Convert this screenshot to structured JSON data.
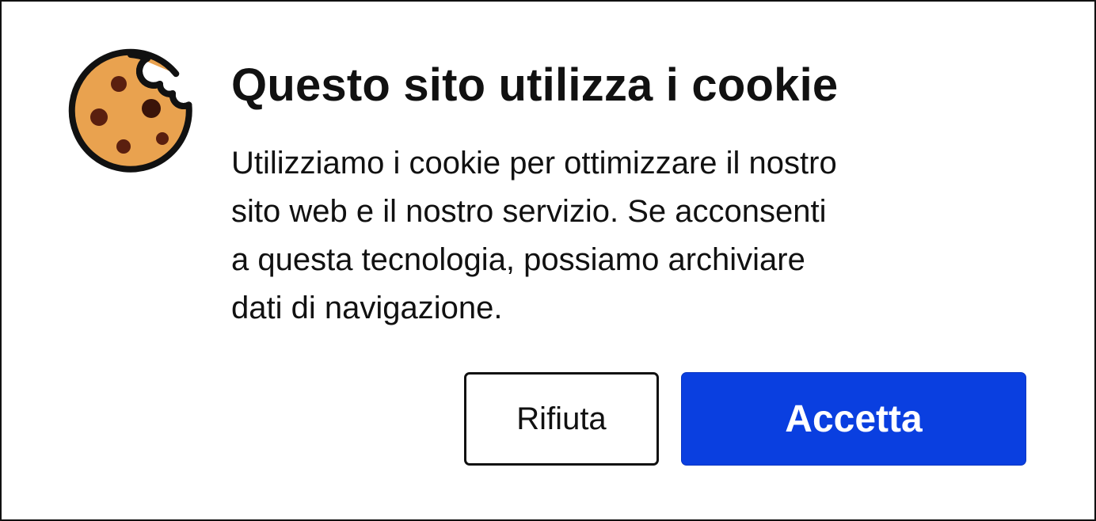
{
  "banner": {
    "icon": "cookie-icon",
    "title": "Questo sito utilizza i cookie",
    "body_lines": [
      "Utilizziamo i cookie per ottimizzare il nostro",
      "sito web e il nostro servizio. Se acconsenti",
      "a questa tecnologia, possiamo archiviare",
      "dati di navigazione."
    ],
    "reject_label": "Rifiuta",
    "accept_label": "Accetta"
  },
  "colors": {
    "accent": "#0a3fe0",
    "cookie_fill": "#e9a24f",
    "cookie_chips": "#5a1f0f",
    "border": "#111111"
  }
}
